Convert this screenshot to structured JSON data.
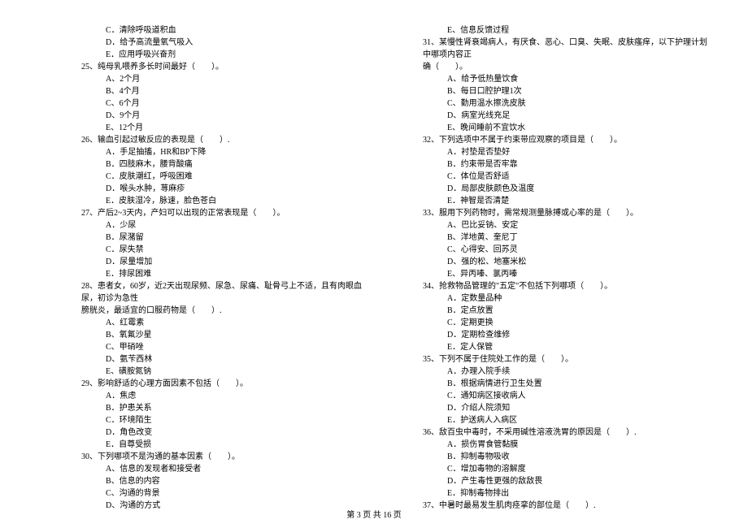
{
  "leftColumn": [
    {
      "type": "option",
      "text": "C．清除呼吸道积血"
    },
    {
      "type": "option",
      "text": "D．给予高流量氧气吸入"
    },
    {
      "type": "option",
      "text": "E．应用呼吸兴奋剂"
    },
    {
      "type": "question",
      "text": "25、纯母乳喂养多长时间最好（　　）。"
    },
    {
      "type": "option",
      "text": "A、2个月"
    },
    {
      "type": "option",
      "text": "B、4个月"
    },
    {
      "type": "option",
      "text": "C、6个月"
    },
    {
      "type": "option",
      "text": "D、9个月"
    },
    {
      "type": "option",
      "text": "E、12个月"
    },
    {
      "type": "question",
      "text": "26、输血引起过敏反应的表现是（　　）."
    },
    {
      "type": "option",
      "text": "A．手足抽搐，HR和BP下降"
    },
    {
      "type": "option",
      "text": "B．四肢麻木，腰背酸痛"
    },
    {
      "type": "option",
      "text": "C．皮肤潮红，呼吸困难"
    },
    {
      "type": "option",
      "text": "D．喉头水肿，荨麻疹"
    },
    {
      "type": "option",
      "text": "E．皮肤湿冷，脉速，脸色苍白"
    },
    {
      "type": "question",
      "text": "27、产后2~3天内，产妇可以出现的正常表现是（　　）。"
    },
    {
      "type": "option",
      "text": "A．少尿"
    },
    {
      "type": "option",
      "text": "B．尿潴留"
    },
    {
      "type": "option",
      "text": "C．尿失禁"
    },
    {
      "type": "option",
      "text": "D．尿量增加"
    },
    {
      "type": "option",
      "text": "E．排尿困难"
    },
    {
      "type": "question",
      "text": "28、患者女，60岁，近2天出现尿频、尿急、尿痛、耻骨弓上不适，且有肉眼血尿，初诊为急性"
    },
    {
      "type": "question-cont",
      "text": "膀胱炎，最适宜的口服药物是（　　）."
    },
    {
      "type": "option",
      "text": "A、红霉素"
    },
    {
      "type": "option",
      "text": "B、氧氟沙星"
    },
    {
      "type": "option",
      "text": "C、甲硝唑"
    },
    {
      "type": "option",
      "text": "D、氨苄西林"
    },
    {
      "type": "option",
      "text": "E、磺胺氮钠"
    },
    {
      "type": "question",
      "text": "29、影响舒适的心理方面因素不包括（　　）。"
    },
    {
      "type": "option",
      "text": "A．焦虑"
    },
    {
      "type": "option",
      "text": "B．护患关系"
    },
    {
      "type": "option",
      "text": "C．环境陌生"
    },
    {
      "type": "option",
      "text": "D．角色改变"
    },
    {
      "type": "option",
      "text": "E．自尊受损"
    },
    {
      "type": "question",
      "text": "30、下列哪项不是沟通的基本因素（　　）。"
    },
    {
      "type": "option",
      "text": "A、信息的发现者和接受者"
    },
    {
      "type": "option",
      "text": "B、信息的内容"
    },
    {
      "type": "option",
      "text": "C、沟通的背景"
    },
    {
      "type": "option",
      "text": "D、沟通的方式"
    }
  ],
  "rightColumn": [
    {
      "type": "option",
      "text": "E、信息反馈过程"
    },
    {
      "type": "question",
      "text": "31、某慢性肾衰竭病人，有厌食、恶心、口臭、失眠、皮肤瘙痒，以下护理计划中哪项内容正"
    },
    {
      "type": "question-cont",
      "text": "确（　　）。"
    },
    {
      "type": "option",
      "text": "A、给予低热量饮食"
    },
    {
      "type": "option",
      "text": "B、每日口腔护理1次"
    },
    {
      "type": "option",
      "text": "C、勤用温水擦洗皮肤"
    },
    {
      "type": "option",
      "text": "D、病室光线充足"
    },
    {
      "type": "option",
      "text": "E、晚间睡前不宜饮水"
    },
    {
      "type": "question",
      "text": "32、下列选项中不属于约束带应观察的项目是（　　）。"
    },
    {
      "type": "option",
      "text": "A．衬垫是否垫好"
    },
    {
      "type": "option",
      "text": "B．约束带是否牢靠"
    },
    {
      "type": "option",
      "text": "C．体位是否舒适"
    },
    {
      "type": "option",
      "text": "D．局部皮肤颜色及温度"
    },
    {
      "type": "option",
      "text": "E．神智是否清楚"
    },
    {
      "type": "question",
      "text": "33、服用下列药物时，需常规测量脉搏或心率的是（　　）。"
    },
    {
      "type": "option",
      "text": "A、巴比妥钠、安定"
    },
    {
      "type": "option",
      "text": "B、洋地黄、奎尼丁"
    },
    {
      "type": "option",
      "text": "C、心得安、回苏灵"
    },
    {
      "type": "option",
      "text": "D、强的松、地塞米松"
    },
    {
      "type": "option",
      "text": "E、异丙嗪、氯丙嗪"
    },
    {
      "type": "question",
      "text": "34、抢救物品管理的\"五定\"不包括下列哪项（　　）。"
    },
    {
      "type": "option",
      "text": "A．定数量品种"
    },
    {
      "type": "option",
      "text": "B．定点放置"
    },
    {
      "type": "option",
      "text": "C．定期更换"
    },
    {
      "type": "option",
      "text": "D．定期检查维修"
    },
    {
      "type": "option",
      "text": "E．定人保管"
    },
    {
      "type": "question",
      "text": "35、下列不属于住院处工作的是（　　）。"
    },
    {
      "type": "option",
      "text": "A．办理入院手续"
    },
    {
      "type": "option",
      "text": "B．根据病情进行卫生处置"
    },
    {
      "type": "option",
      "text": "C．通知病区接收病人"
    },
    {
      "type": "option",
      "text": "D．介绍人院须知"
    },
    {
      "type": "option",
      "text": "E．护送病人入病区"
    },
    {
      "type": "question",
      "text": "36、敌百虫中毒时，不采用碱性溶液洗胃的原因是（　　）."
    },
    {
      "type": "option",
      "text": "A．损伤胃食管黏膜"
    },
    {
      "type": "option",
      "text": "B．抑制毒物吸收"
    },
    {
      "type": "option",
      "text": "C．增加毒物的溶解度"
    },
    {
      "type": "option",
      "text": "D．产生毒性更强的敌敌畏"
    },
    {
      "type": "option",
      "text": "E．抑制毒物排出"
    },
    {
      "type": "question",
      "text": "37、中暑时最易发生肌肉痉挛的部位是（　　）."
    }
  ],
  "footer": "第 3 页 共 16 页"
}
